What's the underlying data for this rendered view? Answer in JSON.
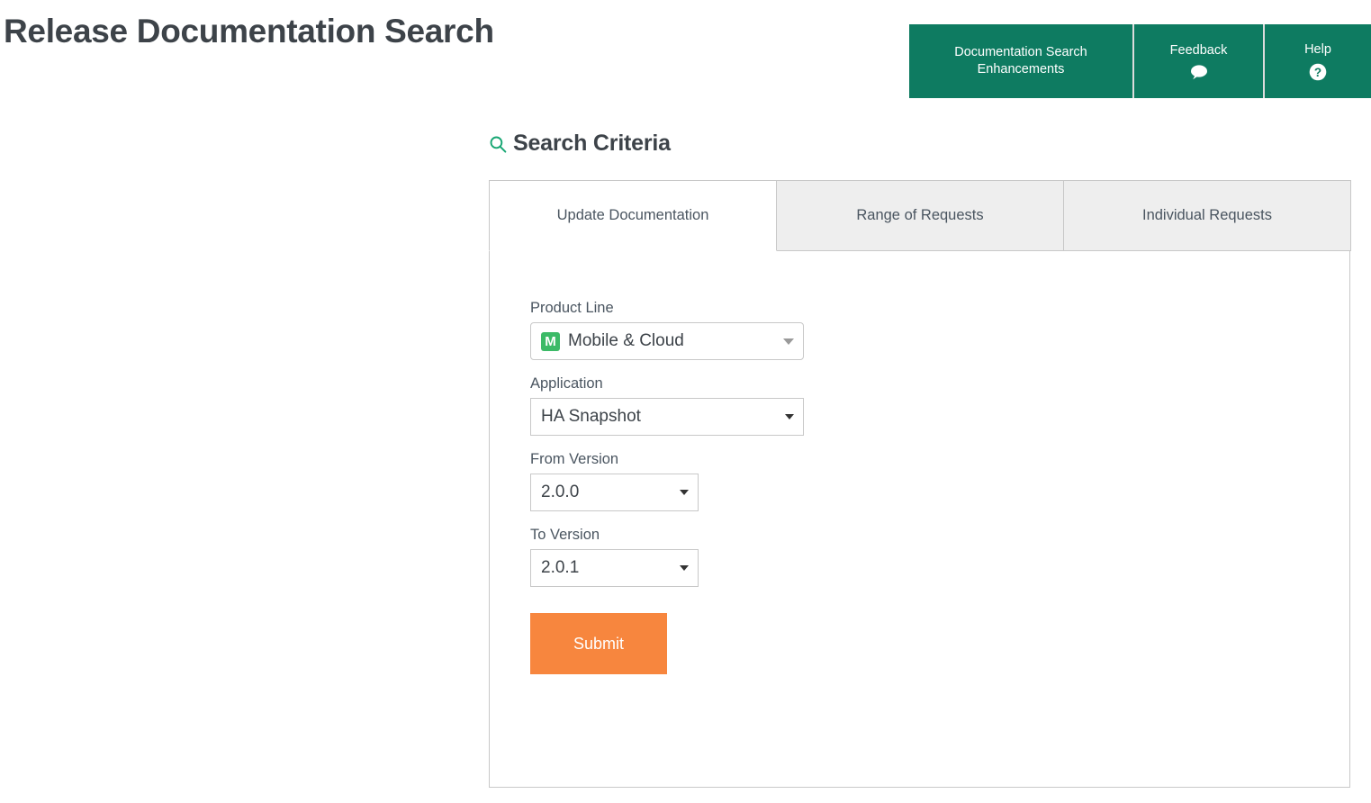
{
  "header": {
    "title": "Release Documentation Search",
    "nav_items": [
      {
        "label": "Documentation Search Enhancements",
        "icon": ""
      },
      {
        "label": "Feedback",
        "icon": "speech-bubble-icon"
      },
      {
        "label": "Help",
        "icon": "question-circle-icon"
      }
    ]
  },
  "section": {
    "heading": "Search Criteria",
    "icon": "search-icon"
  },
  "tabs": [
    {
      "label": "Update Documentation",
      "active": true
    },
    {
      "label": "Range of Requests",
      "active": false
    },
    {
      "label": "Individual Requests",
      "active": false
    }
  ],
  "form": {
    "product_line": {
      "label": "Product Line",
      "value": "Mobile & Cloud",
      "badge": "M"
    },
    "application": {
      "label": "Application",
      "value": "HA Snapshot"
    },
    "from_version": {
      "label": "From Version",
      "value": "2.0.0"
    },
    "to_version": {
      "label": "To Version",
      "value": "2.0.1"
    },
    "submit_label": "Submit"
  },
  "colors": {
    "brand_green": "#0e7b61",
    "accent_orange": "#f7863e",
    "badge_green": "#3cba67",
    "title_grey": "#3d4349"
  }
}
